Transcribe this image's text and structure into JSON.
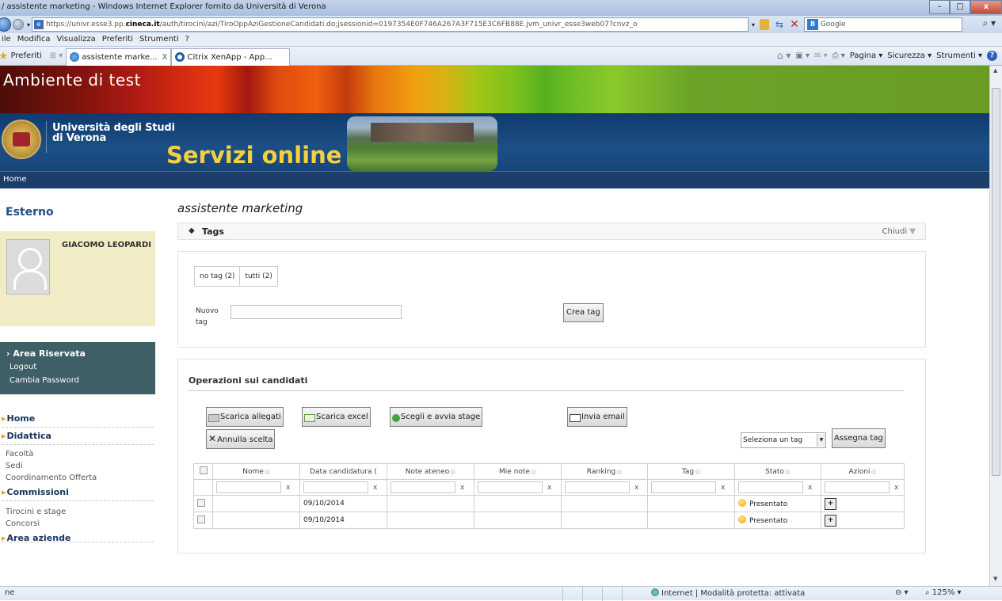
{
  "browser": {
    "title": "/ assistente marketing - Windows Internet Explorer fornito da Università di Verona",
    "url_prefix": "https://univr.esse3.pp.",
    "url_domain": "cineca.it",
    "url_rest": "/auth/tirocini/azi/TiroOppAziGestioneCandidati.do;jsessionid=0197354E0F746A267A3F715E3C6FB88E.jvm_univr_esse3web07?cnvz_o",
    "search_engine": "Google",
    "menu": [
      "ile",
      "Modifica",
      "Visualizza",
      "Preferiti",
      "Strumenti",
      "?"
    ],
    "favorites_label": "Preferiti",
    "tabs": [
      {
        "label": "assistente marke...",
        "close": "X"
      },
      {
        "label": "Citrix XenApp - App..."
      }
    ],
    "commands": {
      "page": "Pagina ▾",
      "security": "Sicurezza ▾",
      "tools": "Strumenti ▾"
    },
    "status": {
      "left": "ne",
      "zone": "Internet | Modalità protetta: attivata",
      "zoom": "125%"
    }
  },
  "site": {
    "env_banner": "Ambiente di test",
    "univ_name_1": "Università degli Studi",
    "univ_name_2": "di Verona",
    "servizi": "Servizi online",
    "home": "Home"
  },
  "sidebar": {
    "section_title": "Esterno",
    "user_name": "GIACOMO LEOPARDI",
    "area_title": "Area Riservata",
    "area_links": [
      "Logout",
      "Cambia Password"
    ],
    "nav": [
      {
        "section": "Home",
        "links": []
      },
      {
        "section": "Didattica",
        "links": [
          "Facoltà",
          "Sedi",
          "Coordinamento Offerta"
        ]
      },
      {
        "section": "Commissioni",
        "links": [
          "Tirocini e stage",
          "Concorsi"
        ]
      }
    ],
    "cut_item": "Area aziende"
  },
  "main": {
    "page_title": "assistente marketing",
    "tags_panel": {
      "title": "Tags",
      "collapse": "Chiudi"
    },
    "filters": [
      "no tag (2)",
      "tutti (2)"
    ],
    "new_tag_label": "Nuovo tag",
    "new_tag_value": "",
    "create_tag_btn": "Crea tag",
    "ops_title": "Operazioni sui candidati",
    "buttons": {
      "download_attachments": "Scarica allegati",
      "download_excel": "Scarica excel",
      "choose_start": "Scegli e avvia stage",
      "send_email": "Invia email",
      "cancel_choice": "Annulla scelta",
      "assign_tag": "Assegna tag"
    },
    "tag_select": "Seleziona un tag",
    "table": {
      "headers": [
        "Nome",
        "Data candidatura (",
        "Note ateneo",
        "Mie note",
        "Ranking",
        "Tag",
        "Stato",
        "Azioni"
      ],
      "filter_clear": "x",
      "rows": [
        {
          "nome": "",
          "data": "09/10/2014",
          "note_ateneo": "",
          "mie_note": "",
          "ranking": "",
          "tag": "",
          "stato": "Presentato"
        },
        {
          "nome": "",
          "data": "09/10/2014",
          "note_ateneo": "",
          "mie_note": "",
          "ranking": "",
          "tag": "",
          "stato": "Presentato"
        }
      ]
    }
  },
  "colors": {
    "accent_blue": "#1d3d6a",
    "header_gold": "#f4d03f",
    "area_box": "#3e5f66",
    "status_yellow": "#f0a500"
  }
}
